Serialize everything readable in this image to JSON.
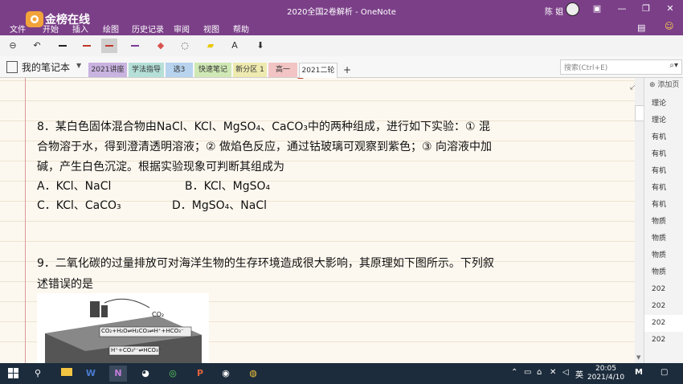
{
  "titlebar": {
    "logo_text": "金榜在线",
    "doc_title": "2020全国2卷解析 - OneNote",
    "user": "陈 姐",
    "menu": [
      "文件",
      "开始",
      "插入",
      "绘图",
      "历史记录",
      "审阅",
      "视图",
      "帮助"
    ],
    "accent_color": "#7b3f88"
  },
  "toolbar": {
    "items": [
      "back-icon",
      "undo-icon",
      "pen-icon",
      "pen-icon",
      "pen-icon",
      "pen-icon",
      "eraser-icon",
      "lasso-icon",
      "highlighter-icon",
      "ink-to-text-icon",
      "ink-to-shape-icon"
    ]
  },
  "notebook": {
    "name": "我的笔记本",
    "sections": [
      {
        "label": "2021讲座",
        "color": "#c9b3e0"
      },
      {
        "label": "学法指导",
        "color": "#b5e0d8"
      },
      {
        "label": "选3",
        "color": "#b7d3ee"
      },
      {
        "label": "快速笔记",
        "color": "#cfe8b5"
      },
      {
        "label": "新分区 1",
        "color": "#eeeab0"
      },
      {
        "label": "高一",
        "color": "#f3c4c4"
      },
      {
        "label": "2021二轮",
        "color": "#ffffff"
      }
    ],
    "add_label": "+",
    "search_placeholder": "搜索(Ctrl+E)"
  },
  "content": {
    "q8_line1": "8．某白色固体混合物由NaCl、KCl、MgSO₄、CaCO₃中的两种组成，进行如下实验：① 混",
    "q8_line2": "合物溶于水，得到澄清透明溶液；② 做焰色反应，通过钴玻璃可观察到紫色；③ 向溶液中加",
    "q8_line3": "碱，产生白色沉淀。根据实验现象可判断其组成为",
    "q8_opt_a": "A．KCl、NaCl",
    "q8_opt_b": "B．KCl、MgSO₄",
    "q8_opt_c": "C．KCl、CaCO₃",
    "q8_opt_d": "D．MgSO₄、NaCl",
    "q9_line1": "9．二氧化碳的过量排放可对海洋生物的生存环境造成很大影响，其原理如下图所示。下列叙",
    "q9_line2": "述错误的是",
    "fig_co2": "CO₂",
    "fig_eq1": "CO₂+H₂O⇌H₂CO₃⇌H⁺+HCO₃⁻",
    "fig_eq2": "H⁺+CO₃²⁻⇌HCO₃⁻"
  },
  "pages_panel": {
    "add_label": "添加页",
    "pages": [
      "理论",
      "理论",
      "有机",
      "有机",
      "有机",
      "有机",
      "有机",
      "物质",
      "物质",
      "物质",
      "物质",
      "202",
      "202",
      "202",
      "202"
    ],
    "selected_index": 13
  },
  "taskbar": {
    "time": "20:05",
    "date": "2021/4/10",
    "ime": "英"
  }
}
